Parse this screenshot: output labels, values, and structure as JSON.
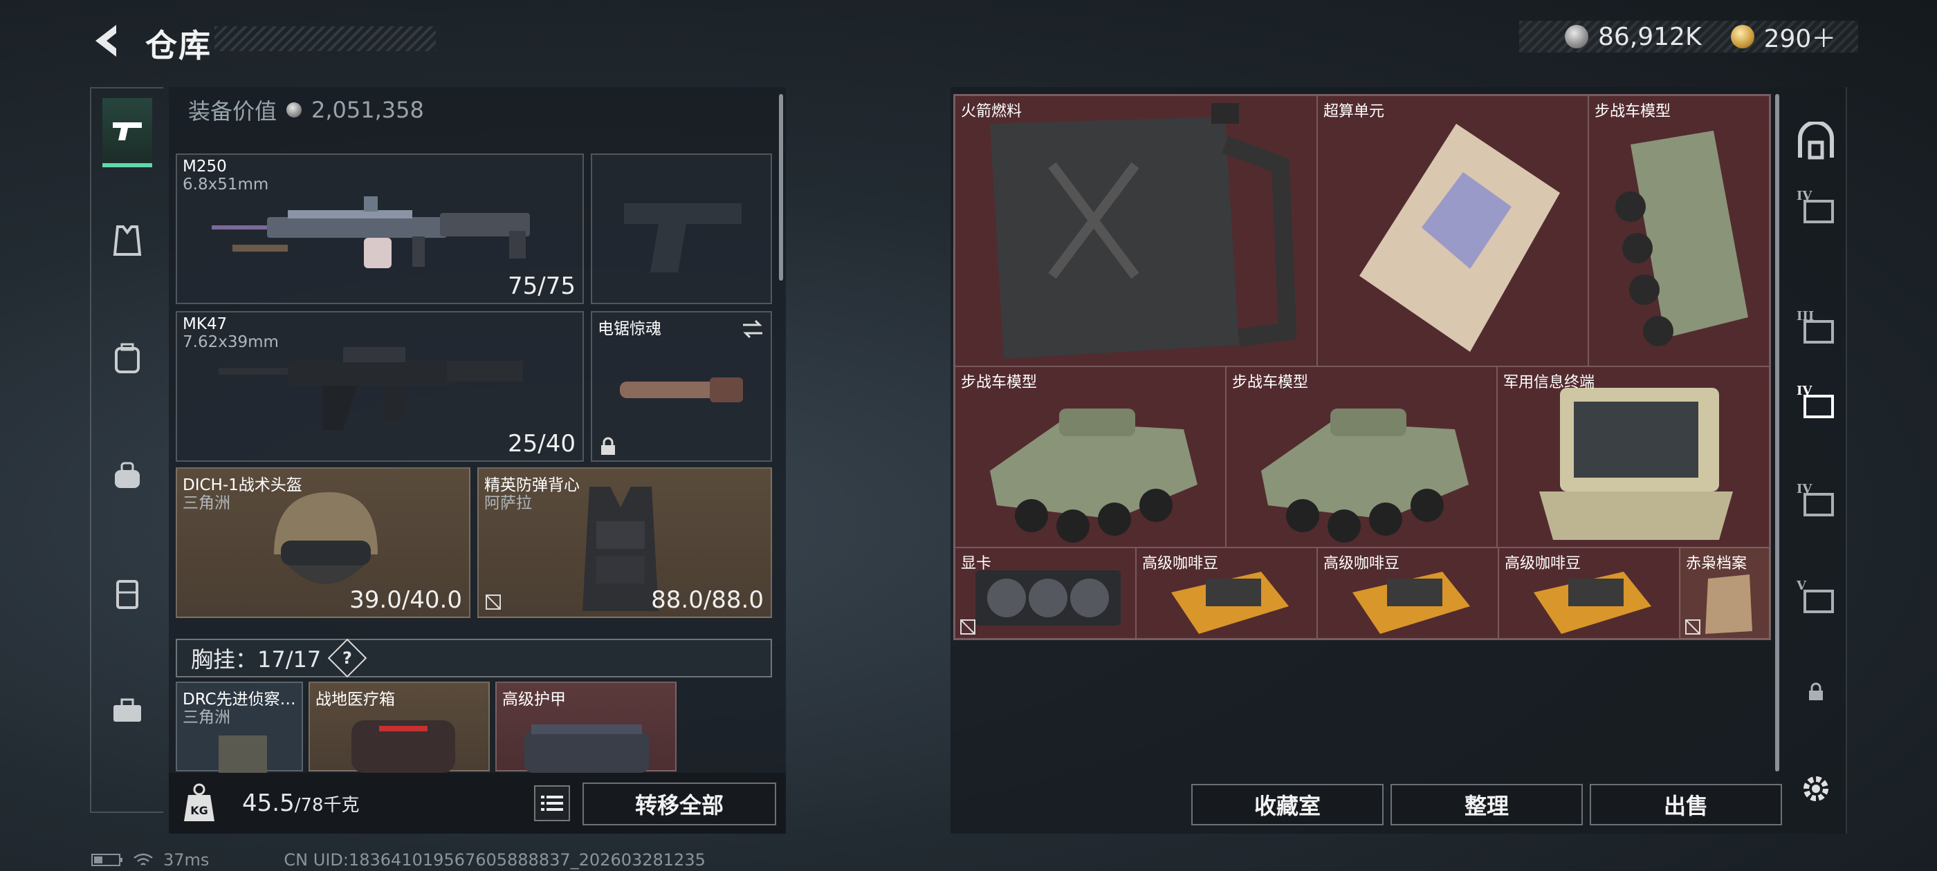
{
  "header": {
    "title": "仓库",
    "currency": [
      {
        "icon": "silver-coin-icon",
        "value": "86,912K"
      },
      {
        "icon": "gold-coin-icon",
        "value": "290＋"
      }
    ]
  },
  "left_rail": {
    "items": [
      {
        "icon": "pistol-icon",
        "active": true
      },
      {
        "icon": "vest-icon",
        "active": false
      },
      {
        "icon": "backpack-icon",
        "active": false
      },
      {
        "icon": "bag-icon",
        "active": false
      },
      {
        "icon": "container-icon",
        "active": false
      },
      {
        "icon": "toolbox-icon",
        "active": false
      }
    ]
  },
  "loadout": {
    "equip_value_label": "装备价值",
    "equip_value": "2,051,358",
    "weapons": [
      {
        "name": "M250",
        "ammo": "6.8x51mm",
        "count": "75/75"
      },
      {
        "name": "MK47",
        "ammo": "7.62x39mm",
        "count": "25/40"
      }
    ],
    "melee": {
      "name": "电锯惊魂"
    },
    "helmet": {
      "name": "DICH-1战术头盔",
      "sub": "三角洲",
      "durability": "39.0/40.0"
    },
    "armor": {
      "name": "精英防弹背心",
      "sub": "阿萨拉",
      "durability": "88.0/88.0"
    },
    "chest_label": "胸挂：17/17",
    "chest_help": "?",
    "chest_items": [
      {
        "name": "DRC先进侦察…",
        "sub": "三角洲"
      },
      {
        "name": "战地医疗箱"
      },
      {
        "name": "高级护甲"
      }
    ],
    "weight_value": "45.5",
    "weight_max": "/78千克",
    "transfer_all": "转移全部"
  },
  "storage": {
    "items": [
      {
        "name": "火箭燃料"
      },
      {
        "name": "超算单元"
      },
      {
        "name": "步战车模型"
      },
      {
        "name": "步战车模型"
      },
      {
        "name": "步战车模型"
      },
      {
        "name": "军用信息终端"
      },
      {
        "name": "显卡"
      },
      {
        "name": "高级咖啡豆"
      },
      {
        "name": "高级咖啡豆"
      },
      {
        "name": "高级咖啡豆"
      },
      {
        "name": "赤枭档案"
      }
    ],
    "buttons": {
      "collection": "收藏室",
      "organize": "整理",
      "sell": "出售"
    }
  },
  "right_rail": {
    "tabs": [
      "vault-tab-icon",
      "tier-iv-case-icon",
      "tier-iii-case-icon",
      "tier-iv-box-icon",
      "tier-iv-pack-icon",
      "tier-v-box-icon",
      "lock-icon",
      "settings-gear-icon"
    ]
  },
  "status": {
    "ping": "37ms",
    "uid": "CN UID:183641019567605888837_202603281235"
  },
  "colors": {
    "accent": "#5fd8a8",
    "storage_bg": "#4a2a2e",
    "slot_brown": "#5a4b3b"
  }
}
